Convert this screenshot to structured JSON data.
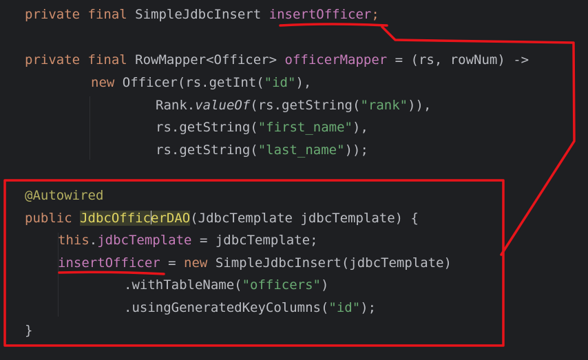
{
  "code": {
    "line1": {
      "kw": "private final ",
      "type": "SimpleJdbcInsert ",
      "field": "insertOfficer",
      "end": ";"
    },
    "line2": {
      "kw": "private final ",
      "type": "RowMapper<Officer> ",
      "field": "officerMapper",
      "rest": " = (rs, rowNum) ->"
    },
    "line3": {
      "kw": "new ",
      "call": "Officer(rs.getInt(",
      "str": "\"id\"",
      "end": "),"
    },
    "line4": {
      "pre": "Rank.",
      "ital": "valueOf",
      "call": "(rs.getString(",
      "str": "\"rank\"",
      "end": ")),"
    },
    "line5": {
      "call": "rs.getString(",
      "str": "\"first_name\"",
      "end": "),"
    },
    "line6": {
      "call": "rs.getString(",
      "str": "\"last_name\"",
      "end": "));"
    },
    "line7": {
      "ann": "@Autowired"
    },
    "line8": {
      "kw": "public ",
      "name_a": "JdbcOffic",
      "name_b": "erDAO",
      "params": "(JdbcTemplate jdbcTemplate) {"
    },
    "line9": {
      "kw": "this",
      "dot": ".",
      "field": "jdbcTemplate",
      "rest": " = jdbcTemplate;"
    },
    "line10": {
      "field": "insertOfficer",
      "eq": " = ",
      "kw": "new ",
      "rest": "SimpleJdbcInsert(jdbcTemplate)"
    },
    "line11": {
      "call": ".withTableName(",
      "str": "\"officers\"",
      "end": ")"
    },
    "line12": {
      "call": ".usingGeneratedKeyColumns(",
      "str": "\"id\"",
      "end": ");"
    },
    "line13": {
      "brace": "}"
    }
  },
  "colors": {
    "annotation_red": "#e8141a",
    "background": "#1e1f22"
  }
}
